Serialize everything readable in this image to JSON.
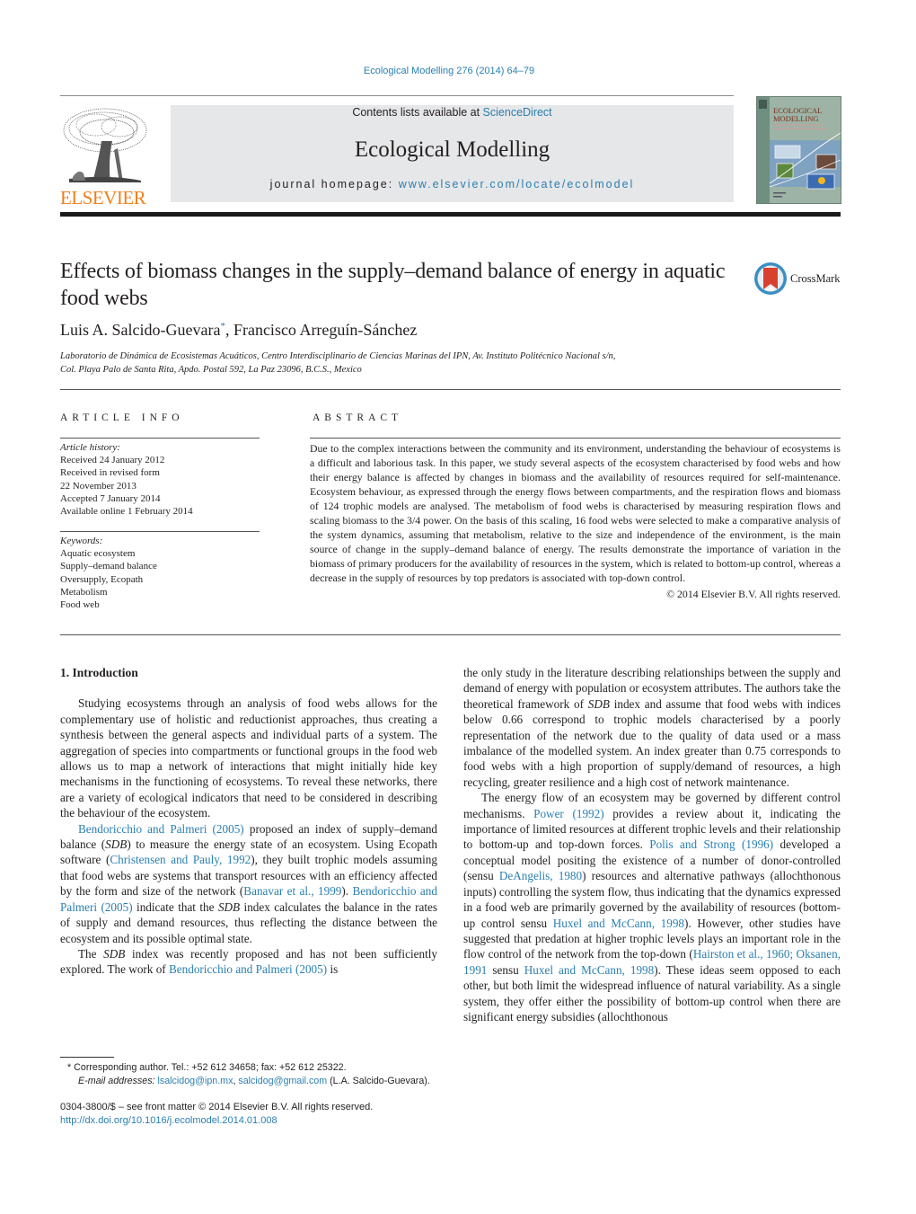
{
  "header": {
    "journal_reference": "Ecological Modelling 276 (2014) 64–79",
    "contents_prefix": "Contents lists available at ",
    "contents_link": "ScienceDirect",
    "journal_title": "Ecological Modelling",
    "homepage_prefix": "journal homepage: ",
    "homepage_link": "www.elsevier.com/locate/ecolmodel",
    "publisher_logo_text": "ELSEVIER",
    "cover_title_line1": "ECOLOGICAL",
    "cover_title_line2": "MODELLING",
    "crossmark_label": "CrossMark"
  },
  "article": {
    "title": "Effects of biomass changes in the supply–demand balance of energy in aquatic food webs",
    "authors": [
      {
        "name": "Luis A. Salcido-Guevara",
        "marker": "*"
      },
      {
        "name": "Francisco Arreguín-Sánchez",
        "marker": ""
      }
    ],
    "author_separator": ", ",
    "affiliation_line1": "Laboratorio de Dinámica de Ecosistemas Acuáticos, Centro Interdisciplinario de Ciencias Marinas del IPN, Av. Instituto Politécnico Nacional s/n,",
    "affiliation_line2": "Col. Playa Palo de Santa Rita, Apdo. Postal 592, La Paz 23096, B.C.S., Mexico"
  },
  "article_info": {
    "heading": "ARTICLE INFO",
    "history_label": "Article history:",
    "history": [
      "Received 24 January 2012",
      "Received in revised form",
      "22 November 2013",
      "Accepted 7 January 2014",
      "Available online 1 February 2014"
    ],
    "keywords_label": "Keywords:",
    "keywords": [
      "Aquatic ecosystem",
      "Supply–demand balance",
      "Oversupply, Ecopath",
      "Metabolism",
      "Food web"
    ]
  },
  "abstract": {
    "heading": "ABSTRACT",
    "text": "Due to the complex interactions between the community and its environment, understanding the behaviour of ecosystems is a difficult and laborious task. In this paper, we study several aspects of the ecosystem characterised by food webs and how their energy balance is affected by changes in biomass and the availability of resources required for self-maintenance. Ecosystem behaviour, as expressed through the energy flows between compartments, and the respiration flows and biomass of 124 trophic models are analysed. The metabolism of food webs is characterised by measuring respiration flows and scaling biomass to the 3/4 power. On the basis of this scaling, 16 food webs were selected to make a comparative analysis of the system dynamics, assuming that metabolism, relative to the size and independence of the environment, is the main source of change in the supply–demand balance of energy. The results demonstrate the importance of variation in the biomass of primary producers for the availability of resources in the system, which is related to bottom-up control, whereas a decrease in the supply of resources by top predators is associated with top-down control.",
    "copyright": "© 2014 Elsevier B.V. All rights reserved."
  },
  "body": {
    "section_heading": "1.  Introduction",
    "col1": {
      "p1": "Studying ecosystems through an analysis of food webs allows for the complementary use of holistic and reductionist approaches, thus creating a synthesis between the general aspects and individual parts of a system. The aggregation of species into compartments or functional groups in the food web allows us to map a network of interactions that might initially hide key mechanisms in the functioning of ecosystems. To reveal these networks, there are a variety of ecological indicators that need to be considered in describing the behaviour of the ecosystem.",
      "p2_cite1": "Bendoricchio and Palmeri (2005)",
      "p2_a": " proposed an index of supply–demand balance (",
      "p2_sdb": "SDB",
      "p2_b": ") to measure the energy state of an ecosystem. Using Ecopath software (",
      "p2_cite2": "Christensen and Pauly, 1992",
      "p2_c": "), they built trophic models assuming that food webs are systems that transport resources with an efficiency affected by the form and size of the network (",
      "p2_cite3": "Banavar et al., 1999",
      "p2_d": "). ",
      "p2_cite4": "Bendoricchio and Palmeri (2005)",
      "p2_e": " indicate that the ",
      "p2_sdb2": "SDB",
      "p2_f": " index calculates the balance in the rates of supply and demand resources, thus reflecting the distance between the ecosystem and its possible optimal state.",
      "p3_a": "The ",
      "p3_sdb": "SDB",
      "p3_b": " index was recently proposed and has not been sufficiently explored. The work of ",
      "p3_cite": "Bendoricchio and Palmeri (2005)",
      "p3_c": " is"
    },
    "col2": {
      "p1_a": "the only study in the literature describing relationships between the supply and demand of energy with population or ecosystem attributes. The authors take the theoretical framework of ",
      "p1_sdb": "SDB",
      "p1_b": " index and assume that food webs with indices below 0.66 correspond to trophic models characterised by a poorly representation of the network due to the quality of data used or a mass imbalance of the modelled system. An index greater than 0.75 corresponds to food webs with a high proportion of supply/demand of resources, a high recycling, greater resilience and a high cost of network maintenance.",
      "p2_a": "The energy flow of an ecosystem may be governed by different control mechanisms. ",
      "p2_cite1": "Power (1992)",
      "p2_b": " provides a review about it, indicating the importance of limited resources at different trophic levels and their relationship to bottom-up and top-down forces. ",
      "p2_cite2": "Polis and Strong (1996)",
      "p2_c": " developed a conceptual model positing the existence of a number of donor-controlled (sensu ",
      "p2_cite3": "DeAngelis, 1980",
      "p2_d": ") resources and alternative pathways (allochthonous inputs) controlling the system flow, thus indicating that the dynamics expressed in a food web are primarily governed by the availability of resources (bottom-up control sensu ",
      "p2_cite4": "Huxel and McCann, 1998",
      "p2_e": "). However, other studies have suggested that predation at higher trophic levels plays an important role in the flow control of the network from the top-down (",
      "p2_cite5": "Hairston et al., 1960; Oksanen, 1991",
      "p2_f": " sensu ",
      "p2_cite6": "Huxel and McCann, 1998",
      "p2_g": "). These ideas seem opposed to each other, but both limit the widespread influence of natural variability. As a single system, they offer either the possibility of bottom-up control when there are significant energy subsidies (allochthonous"
    }
  },
  "footnotes": {
    "corresponding_marker": "*",
    "corresponding": "Corresponding author. Tel.: +52 612 34658; fax: +52 612 25322.",
    "email_label": "E-mail addresses: ",
    "email1": "lsalcidog@ipn.mx",
    "email_sep": ", ",
    "email2": "salcidog@gmail.com",
    "email_owner": " (L.A. Salcido-Guevara).",
    "front_matter": "0304-3800/$ – see front matter © 2014 Elsevier B.V. All rights reserved.",
    "doi": "http://dx.doi.org/10.1016/j.ecolmodel.2014.01.008"
  },
  "colors": {
    "link": "#2a7fb0",
    "elsevier_orange": "#f07f1a",
    "banner_bg": "#e6e7e8",
    "crossmark_red": "#d9412f",
    "crossmark_blue": "#3a8fc4"
  }
}
